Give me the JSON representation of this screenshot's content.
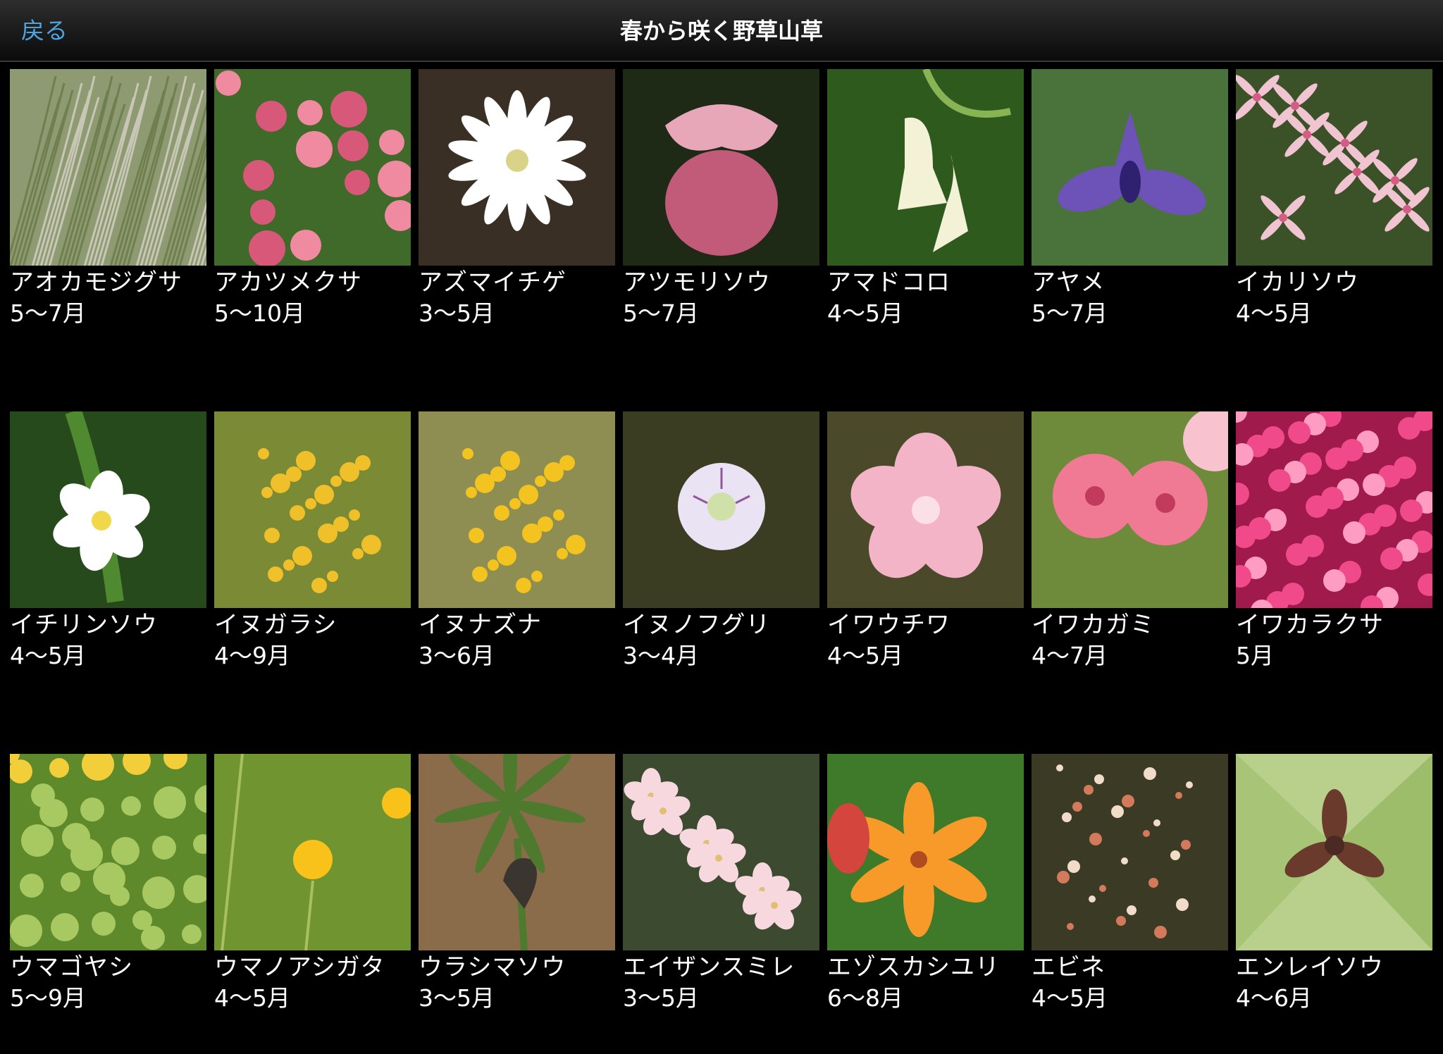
{
  "nav": {
    "back_label": "戻る",
    "title": "春から咲く野草山草"
  },
  "plants": [
    {
      "name": "アオカモジグサ",
      "season": "5〜7月",
      "bg": "#8d9a72",
      "c1": "#c8c6b4",
      "c2": "#6f7f4e",
      "motif": "grass"
    },
    {
      "name": "アカツメクサ",
      "season": "5〜10月",
      "bg": "#3f6a2a",
      "c1": "#d8587a",
      "c2": "#f08aa0",
      "motif": "clover"
    },
    {
      "name": "アズマイチゲ",
      "season": "3〜5月",
      "bg": "#3a2f24",
      "c1": "#ffffff",
      "c2": "#d9d38a",
      "motif": "star"
    },
    {
      "name": "アツモリソウ",
      "season": "5〜7月",
      "bg": "#1f2a16",
      "c1": "#c25a7a",
      "c2": "#e7a7b8",
      "motif": "slipper"
    },
    {
      "name": "アマドコロ",
      "season": "4〜5月",
      "bg": "#2f5a1e",
      "c1": "#f3f1d6",
      "c2": "#88b455",
      "motif": "bell"
    },
    {
      "name": "アヤメ",
      "season": "5〜7月",
      "bg": "#49733a",
      "c1": "#6d52b8",
      "c2": "#2f2070",
      "motif": "iris"
    },
    {
      "name": "イカリソウ",
      "season": "4〜5月",
      "bg": "#3b5228",
      "c1": "#f1c4d2",
      "c2": "#d65c86",
      "motif": "spider"
    },
    {
      "name": "イチリンソウ",
      "season": "4〜5月",
      "bg": "#264a1c",
      "c1": "#ffffff",
      "c2": "#f1d84a",
      "motif": "single"
    },
    {
      "name": "イヌガラシ",
      "season": "4〜9月",
      "bg": "#7b8a35",
      "c1": "#f0c02a",
      "c2": "#5e7a25",
      "motif": "yellowcluster"
    },
    {
      "name": "イヌナズナ",
      "season": "3〜6月",
      "bg": "#8e8e52",
      "c1": "#f3c320",
      "c2": "#6f7d33",
      "motif": "yellowcluster"
    },
    {
      "name": "イヌノフグリ",
      "season": "3〜4月",
      "bg": "#3a3d22",
      "c1": "#eae3f3",
      "c2": "#8f5a9b",
      "motif": "tiny"
    },
    {
      "name": "イワウチワ",
      "season": "4〜5月",
      "bg": "#4a4a2a",
      "c1": "#f2b4c6",
      "c2": "#fbe0e8",
      "motif": "frill"
    },
    {
      "name": "イワカガミ",
      "season": "4〜7月",
      "bg": "#6e8b3c",
      "c1": "#f07a93",
      "c2": "#f9c2cf",
      "motif": "fringes"
    },
    {
      "name": "イワカラクサ",
      "season": "5月",
      "bg": "#a01a4c",
      "c1": "#f04a8a",
      "c2": "#ff9cc2",
      "motif": "carpet"
    },
    {
      "name": "ウマゴヤシ",
      "season": "5〜9月",
      "bg": "#5f8a2c",
      "c1": "#a8c862",
      "c2": "#f2cf3a",
      "motif": "leaves"
    },
    {
      "name": "ウマノアシガタ",
      "season": "4〜5月",
      "bg": "#6f9430",
      "c1": "#f8c21a",
      "c2": "#a8c060",
      "motif": "buttercup"
    },
    {
      "name": "ウラシマソウ",
      "season": "3〜5月",
      "bg": "#8a6b4a",
      "c1": "#4e7a2e",
      "c2": "#3b3530",
      "motif": "arisaema"
    },
    {
      "name": "エイザンスミレ",
      "season": "3〜5月",
      "bg": "#3c4a30",
      "c1": "#f6d8de",
      "c2": "#7d9a5a",
      "motif": "violet"
    },
    {
      "name": "エゾスカシユリ",
      "season": "6〜8月",
      "bg": "#3e7a2a",
      "c1": "#f79a2a",
      "c2": "#d4453e",
      "motif": "lily"
    },
    {
      "name": "エビネ",
      "season": "4〜5月",
      "bg": "#3b3a24",
      "c1": "#d47a5c",
      "c2": "#f0dcc8",
      "motif": "orchid"
    },
    {
      "name": "エンレイソウ",
      "season": "4〜6月",
      "bg": "#b9d08c",
      "c1": "#6a3a2c",
      "c2": "#8fb555",
      "motif": "trillium"
    }
  ]
}
